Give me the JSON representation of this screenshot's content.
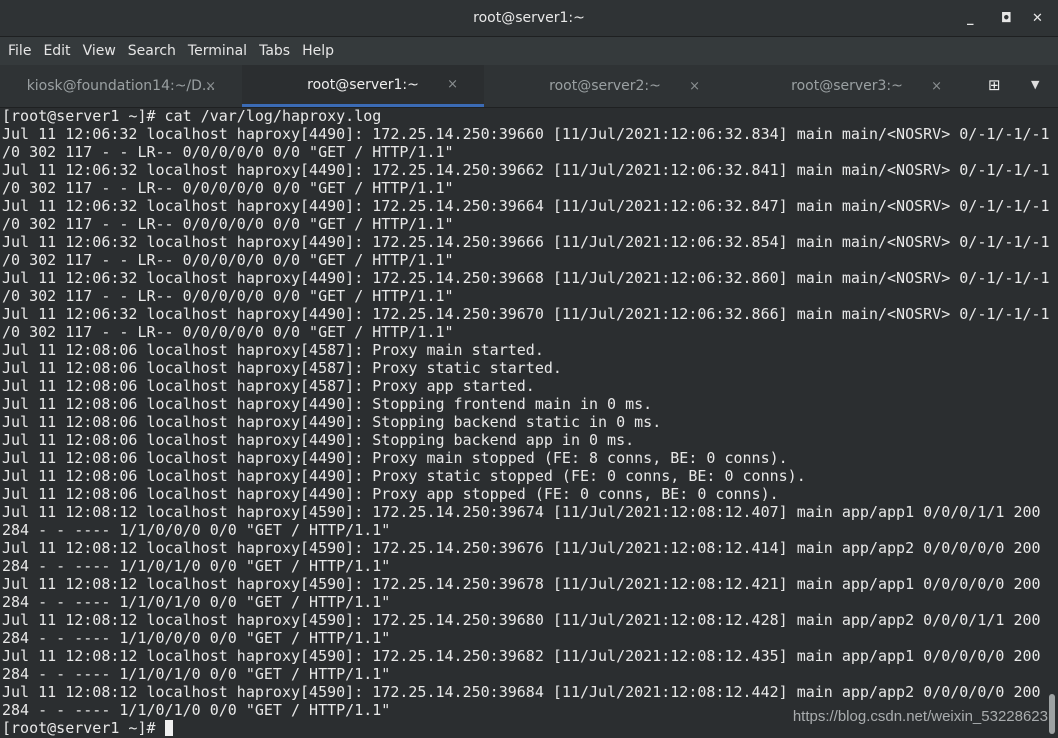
{
  "window": {
    "title": "root@server1:~",
    "minimize_icon": "minimize-icon",
    "maximize_icon": "maximize-icon",
    "close_icon": "close-icon"
  },
  "menu": [
    "File",
    "Edit",
    "View",
    "Search",
    "Terminal",
    "Tabs",
    "Help"
  ],
  "tabs": [
    {
      "label": "kiosk@foundation14:~/D...",
      "active": false
    },
    {
      "label": "root@server1:~",
      "active": true
    },
    {
      "label": "root@server2:~",
      "active": false
    },
    {
      "label": "root@server3:~",
      "active": false
    }
  ],
  "tab_close": "×",
  "accent": "#3b6bb5",
  "terminal": {
    "lines": [
      "[root@server1 ~]# cat /var/log/haproxy.log",
      "Jul 11 12:06:32 localhost haproxy[4490]: 172.25.14.250:39660 [11/Jul/2021:12:06:32.834] main main/<NOSRV> 0/-1/-1/-1",
      "/0 302 117 - - LR-- 0/0/0/0/0 0/0 \"GET / HTTP/1.1\"",
      "Jul 11 12:06:32 localhost haproxy[4490]: 172.25.14.250:39662 [11/Jul/2021:12:06:32.841] main main/<NOSRV> 0/-1/-1/-1",
      "/0 302 117 - - LR-- 0/0/0/0/0 0/0 \"GET / HTTP/1.1\"",
      "Jul 11 12:06:32 localhost haproxy[4490]: 172.25.14.250:39664 [11/Jul/2021:12:06:32.847] main main/<NOSRV> 0/-1/-1/-1",
      "/0 302 117 - - LR-- 0/0/0/0/0 0/0 \"GET / HTTP/1.1\"",
      "Jul 11 12:06:32 localhost haproxy[4490]: 172.25.14.250:39666 [11/Jul/2021:12:06:32.854] main main/<NOSRV> 0/-1/-1/-1",
      "/0 302 117 - - LR-- 0/0/0/0/0 0/0 \"GET / HTTP/1.1\"",
      "Jul 11 12:06:32 localhost haproxy[4490]: 172.25.14.250:39668 [11/Jul/2021:12:06:32.860] main main/<NOSRV> 0/-1/-1/-1",
      "/0 302 117 - - LR-- 0/0/0/0/0 0/0 \"GET / HTTP/1.1\"",
      "Jul 11 12:06:32 localhost haproxy[4490]: 172.25.14.250:39670 [11/Jul/2021:12:06:32.866] main main/<NOSRV> 0/-1/-1/-1",
      "/0 302 117 - - LR-- 0/0/0/0/0 0/0 \"GET / HTTP/1.1\"",
      "Jul 11 12:08:06 localhost haproxy[4587]: Proxy main started.",
      "Jul 11 12:08:06 localhost haproxy[4587]: Proxy static started.",
      "Jul 11 12:08:06 localhost haproxy[4587]: Proxy app started.",
      "Jul 11 12:08:06 localhost haproxy[4490]: Stopping frontend main in 0 ms.",
      "Jul 11 12:08:06 localhost haproxy[4490]: Stopping backend static in 0 ms.",
      "Jul 11 12:08:06 localhost haproxy[4490]: Stopping backend app in 0 ms.",
      "Jul 11 12:08:06 localhost haproxy[4490]: Proxy main stopped (FE: 8 conns, BE: 0 conns).",
      "Jul 11 12:08:06 localhost haproxy[4490]: Proxy static stopped (FE: 0 conns, BE: 0 conns).",
      "Jul 11 12:08:06 localhost haproxy[4490]: Proxy app stopped (FE: 0 conns, BE: 0 conns).",
      "Jul 11 12:08:12 localhost haproxy[4590]: 172.25.14.250:39674 [11/Jul/2021:12:08:12.407] main app/app1 0/0/0/1/1 200",
      "284 - - ---- 1/1/0/0/0 0/0 \"GET / HTTP/1.1\"",
      "Jul 11 12:08:12 localhost haproxy[4590]: 172.25.14.250:39676 [11/Jul/2021:12:08:12.414] main app/app2 0/0/0/0/0 200",
      "284 - - ---- 1/1/0/1/0 0/0 \"GET / HTTP/1.1\"",
      "Jul 11 12:08:12 localhost haproxy[4590]: 172.25.14.250:39678 [11/Jul/2021:12:08:12.421] main app/app1 0/0/0/0/0 200",
      "284 - - ---- 1/1/0/1/0 0/0 \"GET / HTTP/1.1\"",
      "Jul 11 12:08:12 localhost haproxy[4590]: 172.25.14.250:39680 [11/Jul/2021:12:08:12.428] main app/app2 0/0/0/1/1 200",
      "284 - - ---- 1/1/0/0/0 0/0 \"GET / HTTP/1.1\"",
      "Jul 11 12:08:12 localhost haproxy[4590]: 172.25.14.250:39682 [11/Jul/2021:12:08:12.435] main app/app1 0/0/0/0/0 200",
      "284 - - ---- 1/1/0/1/0 0/0 \"GET / HTTP/1.1\"",
      "Jul 11 12:08:12 localhost haproxy[4590]: 172.25.14.250:39684 [11/Jul/2021:12:08:12.442] main app/app2 0/0/0/0/0 200",
      "284 - - ---- 1/1/0/1/0 0/0 \"GET / HTTP/1.1\""
    ],
    "prompt": "[root@server1 ~]# "
  },
  "watermark": "https://blog.csdn.net/weixin_53228623"
}
